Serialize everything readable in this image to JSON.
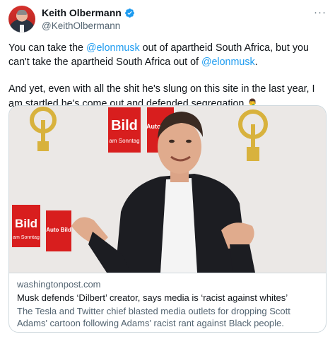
{
  "user": {
    "display_name": "Keith Olbermann",
    "handle": "@KeithOlbermann",
    "verified": true,
    "avatar_icon": "avatar-photo"
  },
  "menu": {
    "more_label": "···"
  },
  "tweet": {
    "p1_part1": "You can take the ",
    "p1_mention1": "@elonmusk",
    "p1_part2": " out of apartheid South Africa, but you can't take the apartheid South Africa out of ",
    "p1_mention2": "@elonmusk",
    "p1_part3": ".",
    "p2_text": "And yet, even with all the shit he's slung on this site in the last year, I am startled he's come out and defended segregation ",
    "p2_emoji": "🤦‍♂️"
  },
  "card": {
    "image_signs": [
      "Bild",
      "am Sonntag",
      "Auto Bild",
      "Bild",
      "am Sonntag",
      "Auto Bild"
    ],
    "domain": "washingtonpost.com",
    "title": "Musk defends ‘Dilbert’ creator, says media is ‘racist against whites’",
    "description": "The Tesla and Twitter chief blasted media outlets for dropping Scott Adams' cartoon following Adams' racist rant against Black people."
  },
  "colors": {
    "link": "#1d9bf0",
    "verified": "#1d9bf0",
    "secondary_text": "#536471",
    "border": "#cfd9de",
    "bild_red": "#d81e1e"
  }
}
